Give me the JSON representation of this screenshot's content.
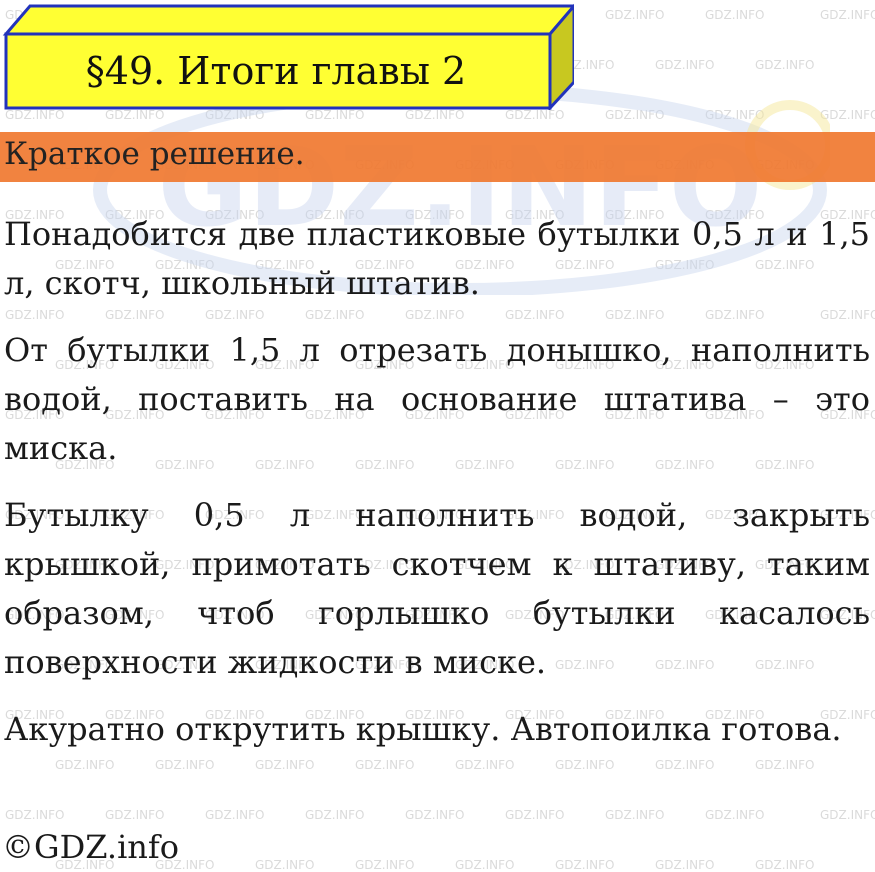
{
  "header": {
    "title": "§49. Итоги главы 2"
  },
  "banner": {
    "label": "Краткое решение."
  },
  "content": {
    "paragraphs": [
      "Понадобится две пластиковые бутылки 0,5 л и 1,5 л, скотч, школьный штатив.",
      "От бутылки 1,5 л отрезать донышко, наполнить водой, поставить на основание штатива – это миска.",
      "Бутылку 0,5 л наполнить водой, закрыть крышкой, примотать скотчем к штативу, таким образом, чтоб горлышко бутылки касалось поверхности жидкости в миске.",
      "Акуратно открутить крышку. Автопоилка готова."
    ]
  },
  "footer": {
    "copyright": "©GDZ.info"
  },
  "watermark": {
    "text": "GDZ.INFO",
    "logo_text": "GDZ.INFO"
  },
  "colors": {
    "title_box_fill": "#ffff33",
    "title_box_border": "#2233bb",
    "banner": "#f07830",
    "logo_watermark": "#c8d4ee"
  }
}
